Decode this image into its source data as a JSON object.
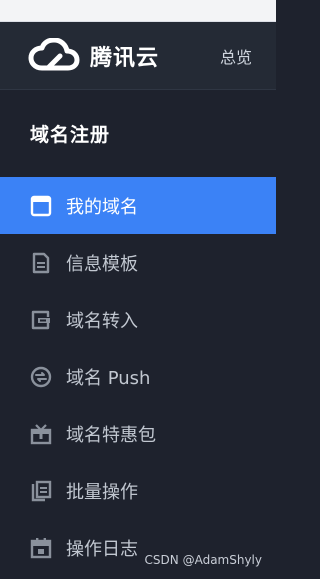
{
  "brand": {
    "name": "腾讯云",
    "logo_icon": "cloud-logo-icon"
  },
  "header": {
    "overview_label": "总览"
  },
  "sidebar": {
    "section_title": "域名注册",
    "items": [
      {
        "label": "我的域名",
        "icon": "window-icon",
        "active": true
      },
      {
        "label": "信息模板",
        "icon": "document-icon",
        "active": false
      },
      {
        "label": "域名转入",
        "icon": "transfer-in-icon",
        "active": false
      },
      {
        "label": "域名 Push",
        "icon": "push-icon",
        "active": false
      },
      {
        "label": "域名特惠包",
        "icon": "gift-icon",
        "active": false
      },
      {
        "label": "批量操作",
        "icon": "batch-icon",
        "active": false
      },
      {
        "label": "操作日志",
        "icon": "calendar-icon",
        "active": false
      }
    ]
  },
  "watermark": "CSDN @AdamShyly",
  "colors": {
    "sidebar_bg": "#1e222d",
    "header_bg": "#242a35",
    "active_bg": "#3b82f6",
    "text_muted": "#c1c7d0"
  }
}
